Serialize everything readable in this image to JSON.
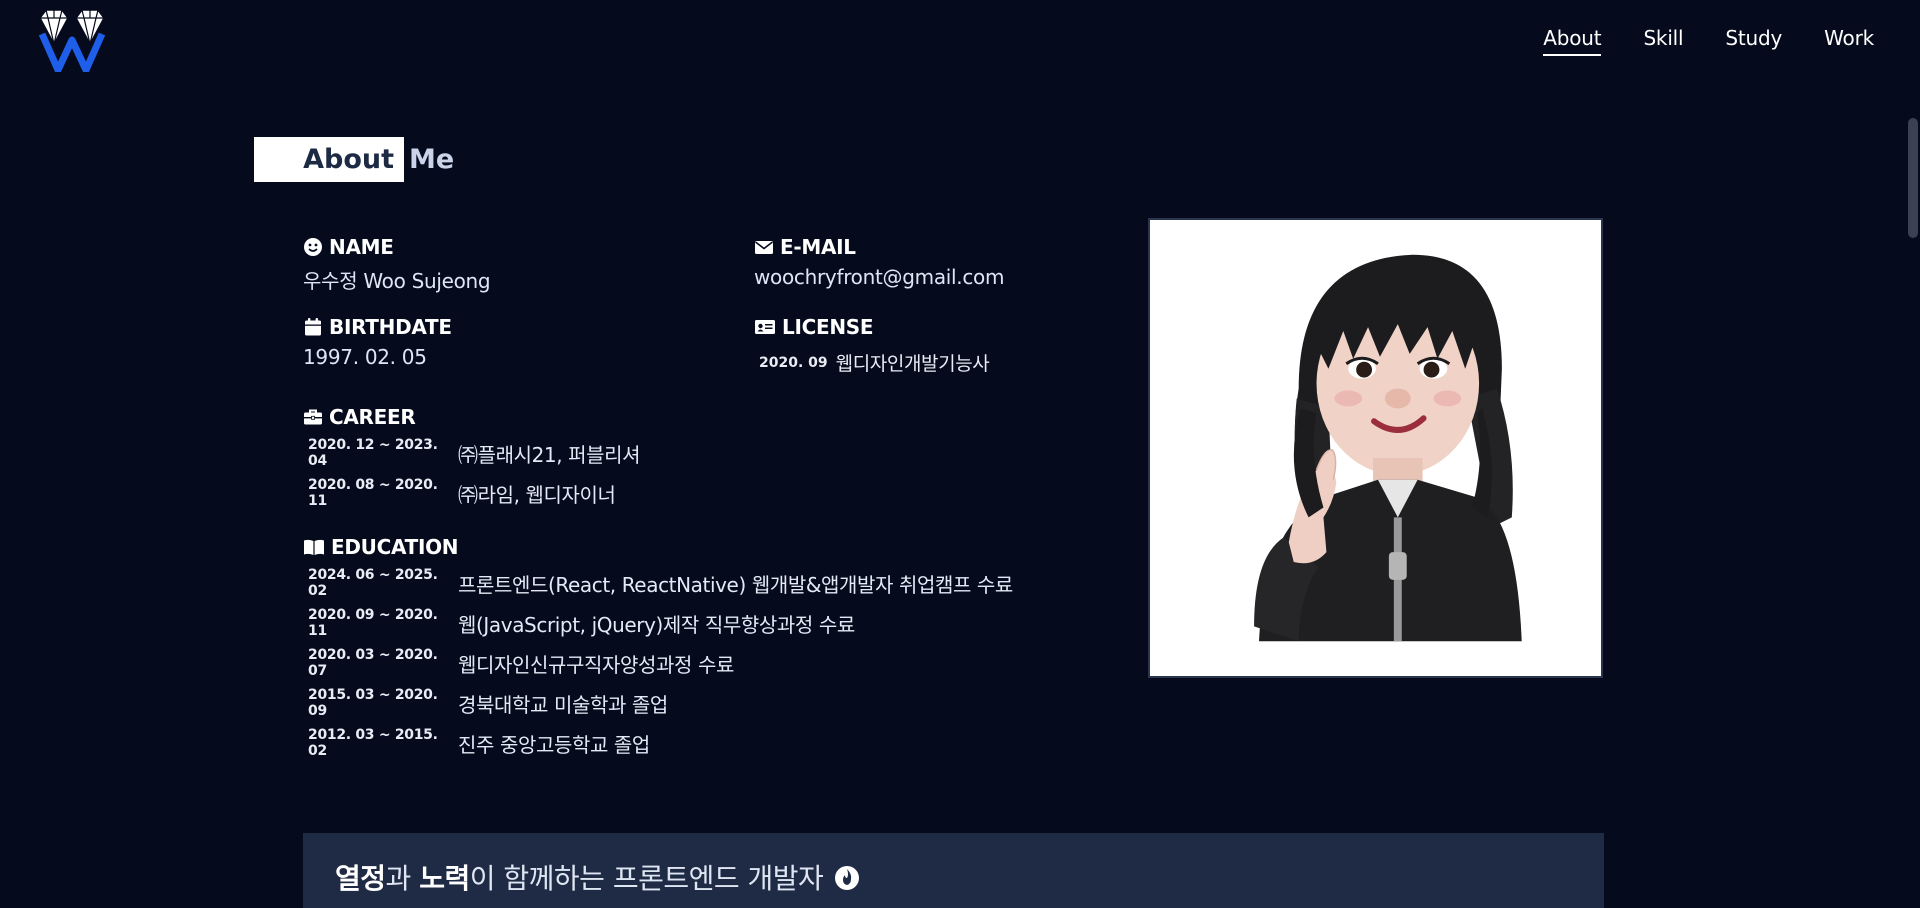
{
  "nav": {
    "items": [
      {
        "label": "About",
        "active": true
      },
      {
        "label": "Skill",
        "active": false
      },
      {
        "label": "Study",
        "active": false
      },
      {
        "label": "Work",
        "active": false
      }
    ]
  },
  "section": {
    "title_highlight": "About",
    "title_rest": "Me"
  },
  "profile": {
    "name_label": "NAME",
    "name_value": "우수정 Woo Sujeong",
    "email_label": "E-MAIL",
    "email_value": "woochryfront@gmail.com",
    "birth_label": "BIRTHDATE",
    "birth_value": "1997. 02. 05",
    "license_label": "LICENSE",
    "license_date": "2020. 09",
    "license_value": "웹디자인개발기능사"
  },
  "career": {
    "label": "CAREER",
    "items": [
      {
        "date": "2020. 12 ~ 2023. 04",
        "desc": "㈜플래시21, 퍼블리셔"
      },
      {
        "date": "2020. 08 ~ 2020. 11",
        "desc": "㈜라임, 웹디자이너"
      }
    ]
  },
  "education": {
    "label": "EDUCATION",
    "items": [
      {
        "date": "2024. 06 ~ 2025. 02",
        "desc": "프론트엔드(React, ReactNative) 웹개발&앱개발자 취업캠프 수료"
      },
      {
        "date": "2020. 09 ~ 2020. 11",
        "desc": "웹(JavaScript, jQuery)제작 직무향상과정 수료"
      },
      {
        "date": "2020. 03 ~ 2020. 07",
        "desc": "웹디자인신규구직자양성과정 수료"
      },
      {
        "date": "2015. 03 ~ 2020. 09",
        "desc": "경북대학교 미술학과 졸업"
      },
      {
        "date": "2012. 03 ~ 2015. 02",
        "desc": "진주 중앙고등학교 졸업"
      }
    ]
  },
  "banner": {
    "word1": "열정",
    "part1": "과 ",
    "word2": "노력",
    "part2": "이 함께하는 프론트엔드 개발자"
  },
  "colors": {
    "background": "#050a1c",
    "banner": "#1f2a44",
    "logo_blue": "#1e5ee8"
  },
  "icons": [
    "logo-icon",
    "smile-icon",
    "envelope-icon",
    "calendar-icon",
    "id-card-icon",
    "briefcase-icon",
    "book-icon",
    "fire-icon"
  ]
}
